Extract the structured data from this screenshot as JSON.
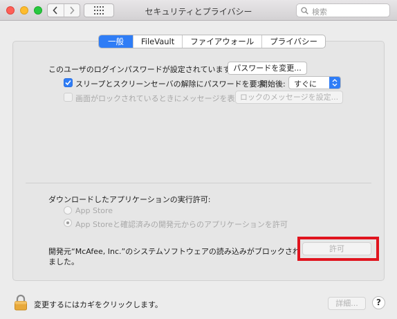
{
  "window": {
    "title": "セキュリティとプライバシー",
    "search_placeholder": "検索"
  },
  "tabs": [
    {
      "label": "一般",
      "active": true
    },
    {
      "label": "FileVault",
      "active": false
    },
    {
      "label": "ファイアウォール",
      "active": false
    },
    {
      "label": "プライバシー",
      "active": false
    }
  ],
  "general": {
    "login_password_text": "このユーザのログインパスワードが設定されています",
    "change_password_button": "パスワードを変更...",
    "require_password_label": "スリープとスクリーンセーバの解除にパスワードを要求",
    "require_password_checked": true,
    "start_label": "開始後:",
    "start_value": "すぐに",
    "lock_message_label": "画面がロックされているときにメッセージを表示",
    "lock_message_checked": false,
    "lock_message_button": "ロックのメッセージを設定..."
  },
  "downloads": {
    "heading": "ダウンロードしたアプリケーションの実行許可:",
    "options": [
      {
        "label": "App Store",
        "selected": false
      },
      {
        "label": "App Storeと確認済みの開発元からのアプリケーションを許可",
        "selected": true
      }
    ],
    "blocked_line1": "開発元“McAfee, Inc.”のシステムソフトウェアの読み込みがブロックされ",
    "blocked_line2": "ました。",
    "allow_button": "許可"
  },
  "footer": {
    "lock_text": "変更するにはカギをクリックします。",
    "advanced_button": "詳細...",
    "help_label": "?"
  },
  "colors": {
    "accent": "#2f7df6",
    "highlight_border": "#e0141e"
  }
}
